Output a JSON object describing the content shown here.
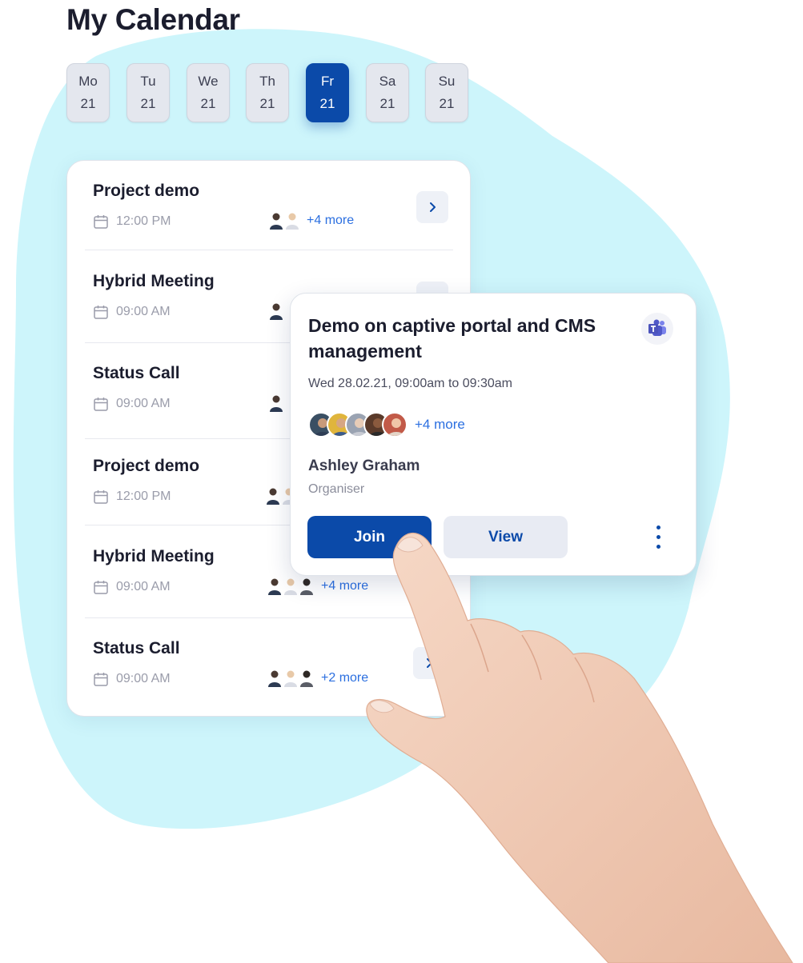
{
  "page": {
    "title": "My Calendar"
  },
  "week": [
    {
      "name": "Mo",
      "date": "21",
      "active": false
    },
    {
      "name": "Tu",
      "date": "21",
      "active": false
    },
    {
      "name": "We",
      "date": "21",
      "active": false
    },
    {
      "name": "Th",
      "date": "21",
      "active": false
    },
    {
      "name": "Fr",
      "date": "21",
      "active": true
    },
    {
      "name": "Sa",
      "date": "21",
      "active": false
    },
    {
      "name": "Su",
      "date": "21",
      "active": false
    }
  ],
  "events": [
    {
      "title": "Project demo",
      "time": "12:00 PM",
      "more": "+4 more"
    },
    {
      "title": "Hybrid Meeting",
      "time": "09:00 AM",
      "more": ""
    },
    {
      "title": "Status Call",
      "time": "09:00 AM",
      "more": ""
    },
    {
      "title": "Project demo",
      "time": "12:00 PM",
      "more": ""
    },
    {
      "title": "Hybrid Meeting",
      "time": "09:00 AM",
      "more": "+4 more"
    },
    {
      "title": "Status Call",
      "time": "09:00 AM",
      "more": "+2 more"
    }
  ],
  "popup": {
    "title": "Demo on captive portal and CMS management",
    "datetime": "Wed 28.02.21, 09:00am to 09:30am",
    "more": "+4 more",
    "organiser_name": "Ashley Graham",
    "organiser_role": "Organiser",
    "join_label": "Join",
    "view_label": "View"
  },
  "icons": {
    "calendar": "calendar-icon",
    "chevron": "chevron-right-icon",
    "teams": "microsoft-teams-icon",
    "menu": "more-vertical-icon"
  },
  "colors": {
    "primary": "#0b4aa9",
    "link": "#2b6fe0",
    "blob": "#cdf5fb",
    "day_bg": "#e4e7ee",
    "title": "#1b1d2e"
  }
}
